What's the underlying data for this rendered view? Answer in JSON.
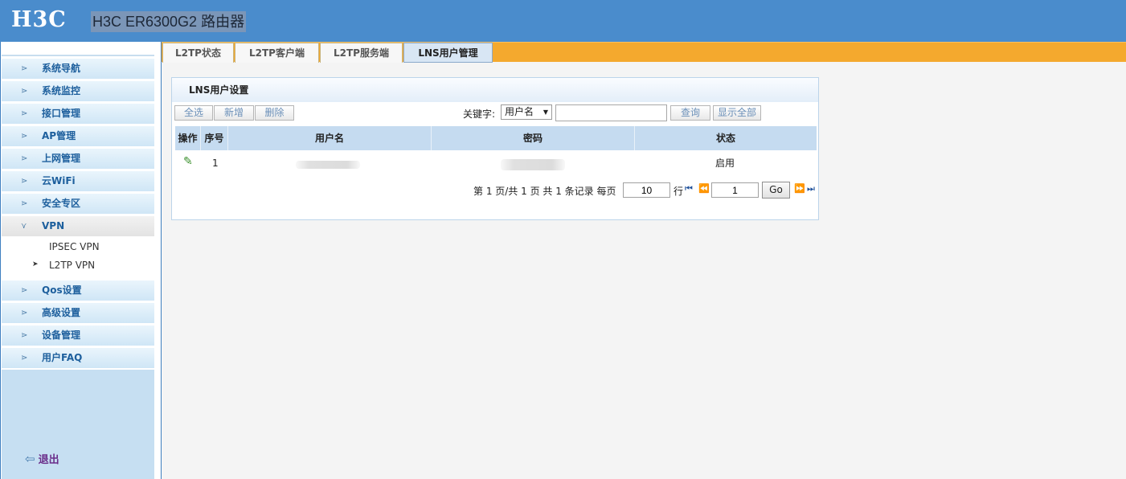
{
  "header": {
    "logo": "H3C",
    "title": "H3C ER6300G2 路由器"
  },
  "tabs": [
    {
      "label": "L2TP状态"
    },
    {
      "label": "L2TP客户端"
    },
    {
      "label": "L2TP服务端"
    },
    {
      "label": "LNS用户管理",
      "active": true
    }
  ],
  "sidebar": {
    "items": [
      {
        "label": "系统导航"
      },
      {
        "label": "系统监控"
      },
      {
        "label": "接口管理"
      },
      {
        "label": "AP管理"
      },
      {
        "label": "上网管理"
      },
      {
        "label": "云WiFi"
      },
      {
        "label": "安全专区"
      },
      {
        "label": "VPN",
        "expanded": true
      },
      {
        "label": "Qos设置"
      },
      {
        "label": "高级设置"
      },
      {
        "label": "设备管理"
      },
      {
        "label": "用户FAQ"
      }
    ],
    "subitems": [
      {
        "label": "IPSEC VPN"
      },
      {
        "label": "L2TP VPN",
        "active": true
      }
    ],
    "logout": "退出"
  },
  "panel": {
    "title": "LNS用户设置",
    "buttons": {
      "select_all": "全选",
      "add": "新增",
      "delete": "删除"
    },
    "search": {
      "label": "关键字:",
      "field": "用户名",
      "value": "",
      "query": "查询",
      "show_all": "显示全部"
    },
    "table": {
      "columns": [
        "操作",
        "序号",
        "用户名",
        "密码",
        "状态"
      ],
      "rows": [
        {
          "index": "1",
          "status": "启用"
        }
      ]
    },
    "pagination": {
      "summary": "第 1 页/共 1 页 共 1 条记录 每页",
      "page_size": "10",
      "rows_label": "行",
      "page": "1",
      "go": "Go"
    }
  },
  "colors": {
    "header": "#4a8ccc",
    "tabbar": "#f4a92e",
    "nav": "#1d5f9d",
    "logout": "#6a2d8a"
  }
}
